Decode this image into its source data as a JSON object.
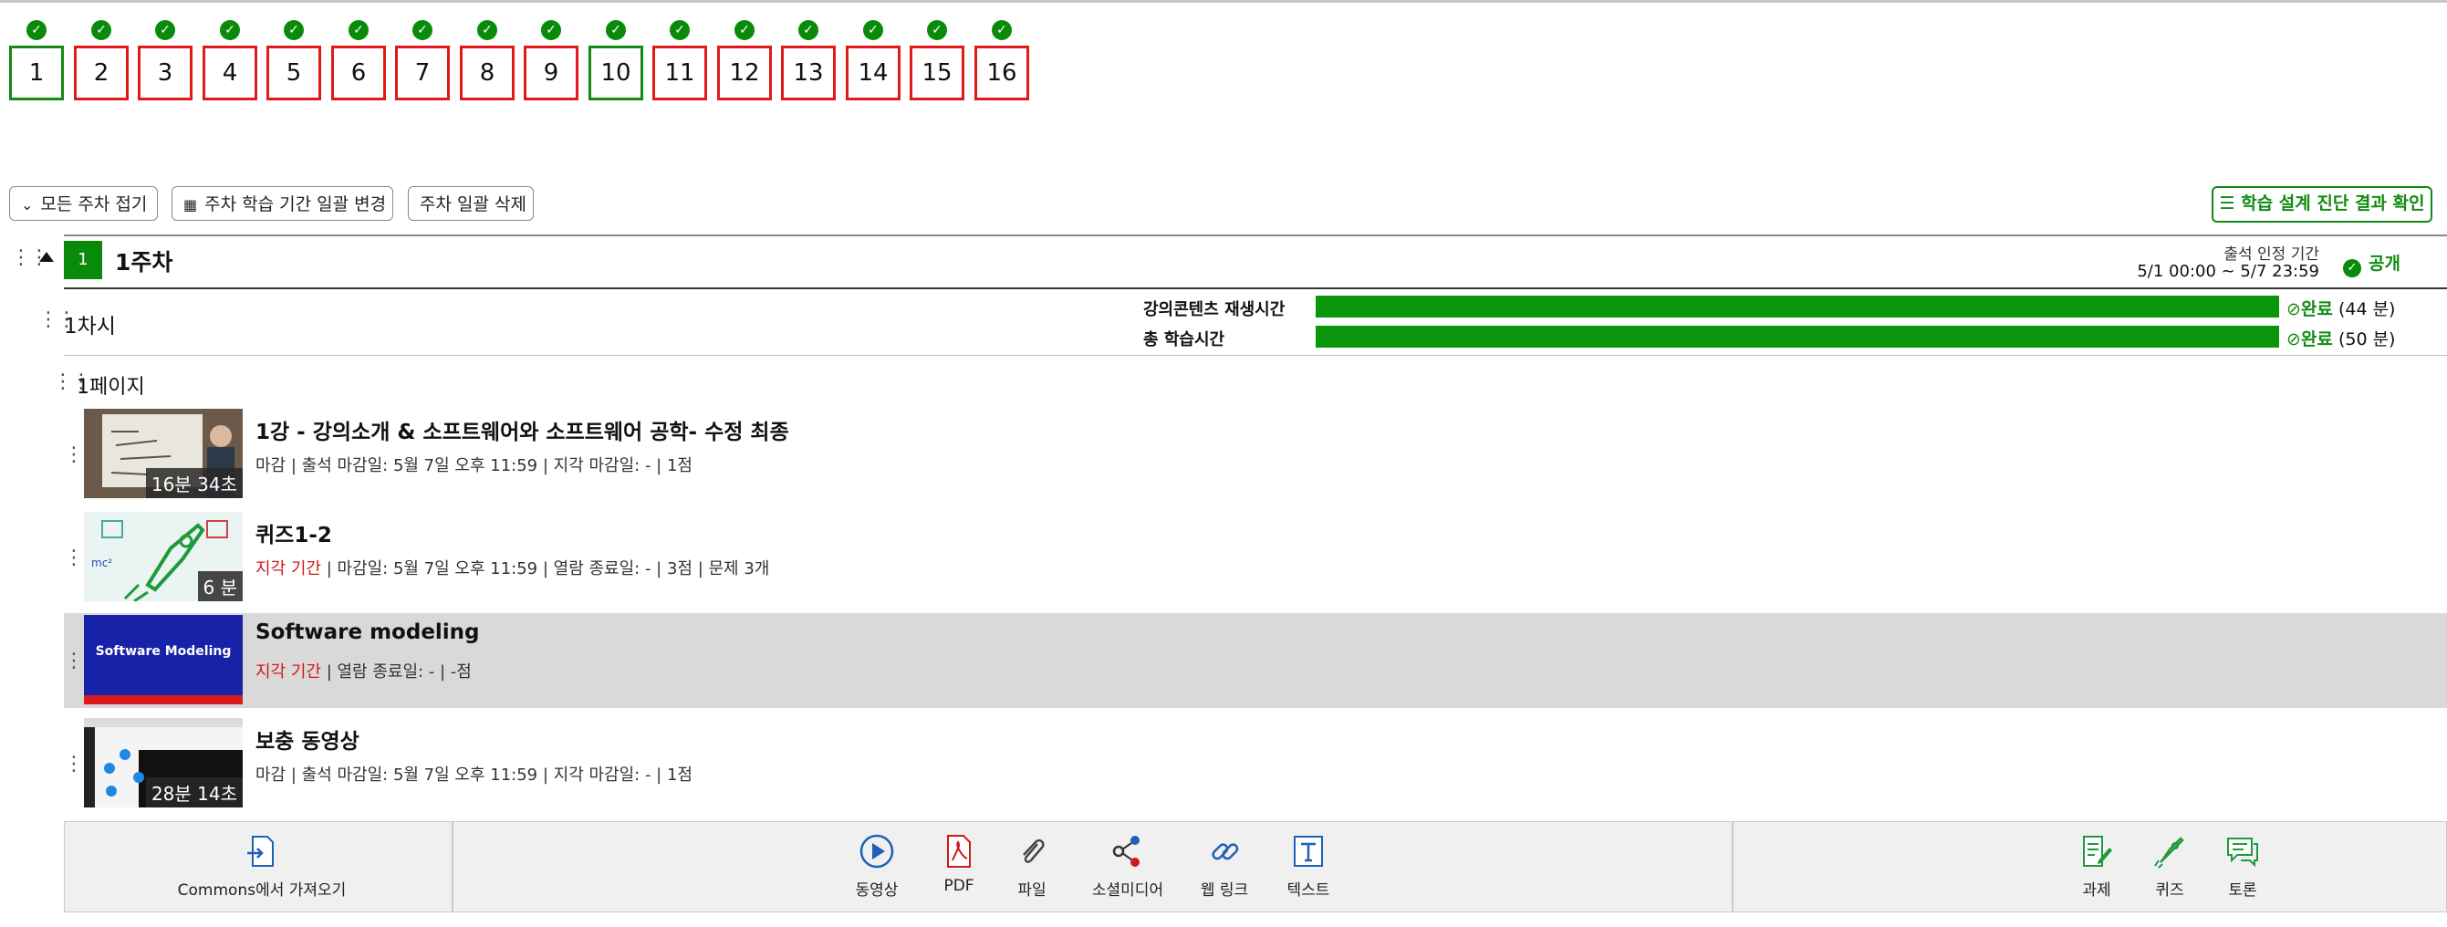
{
  "weeks": [
    {
      "label": "1",
      "status": "current"
    },
    {
      "label": "2",
      "status": "incomplete"
    },
    {
      "label": "3",
      "status": "incomplete"
    },
    {
      "label": "4",
      "status": "incomplete"
    },
    {
      "label": "5",
      "status": "incomplete"
    },
    {
      "label": "6",
      "status": "incomplete"
    },
    {
      "label": "7",
      "status": "incomplete"
    },
    {
      "label": "8",
      "status": "incomplete"
    },
    {
      "label": "9",
      "status": "incomplete"
    },
    {
      "label": "10",
      "status": "complete"
    },
    {
      "label": "11",
      "status": "incomplete"
    },
    {
      "label": "12",
      "status": "incomplete"
    },
    {
      "label": "13",
      "status": "incomplete"
    },
    {
      "label": "14",
      "status": "incomplete"
    },
    {
      "label": "15",
      "status": "incomplete"
    },
    {
      "label": "16",
      "status": "incomplete"
    }
  ],
  "toolbar": {
    "collapse_all": "모든 주차 접기",
    "change_period": "주차 학습 기간 일괄 변경",
    "delete_all": "주차 일괄 삭제",
    "diagnosis": "학습 설계 진단 결과 확인"
  },
  "week": {
    "number": "1",
    "title": "1주차",
    "attendance_label": "출석 인정 기간",
    "attendance_range": "5/1 00:00 ~ 5/7 23:59",
    "visibility": "공개"
  },
  "session": {
    "title": "1차시",
    "progress": [
      {
        "label": "강의콘텐츠 재생시간",
        "status": "완료",
        "detail": "(44 분)",
        "fraction": 1.0
      },
      {
        "label": "총 학습시간",
        "status": "완료",
        "detail": "(50 분)",
        "fraction": 1.0
      }
    ]
  },
  "page": {
    "title": "1페이지"
  },
  "items": [
    {
      "title": "1강 - 강의소개 & 소프트웨어와 소프트웨어 공학- 수정 최종",
      "status": "마감",
      "meta": "| 출석 마감일: 5월 7일 오후 11:59  | 지각 마감일: - | 1점",
      "duration": "16분 34초"
    },
    {
      "title": "퀴즈1-2",
      "status": "지각 기간",
      "meta": "| 마감일: 5월 7일 오후 11:59  | 열람 종료일: - | 3점 | 문제 3개",
      "duration": "6 분"
    },
    {
      "title": "Software modeling",
      "status": "지각 기간",
      "meta": "| 열람 종료일: - | -점",
      "duration": "",
      "thumb_text": "Software Modeling"
    },
    {
      "title": "보충 동영상",
      "status": "마감",
      "meta": "| 출석 마감일: 5월 7일 오후 11:59  | 지각 마감일: - | 1점",
      "duration": "28분 14초"
    }
  ],
  "bottom_tools": {
    "import": "Commons에서 가져오기",
    "video": "동영상",
    "pdf": "PDF",
    "file": "파일",
    "social": "소셜미디어",
    "weblink": "웹 링크",
    "text": "텍스트",
    "assignment": "과제",
    "quiz": "퀴즈",
    "discussion": "토론"
  },
  "colors": {
    "green": "#0a8a0a",
    "red": "#e01919",
    "late": "#d01818"
  }
}
